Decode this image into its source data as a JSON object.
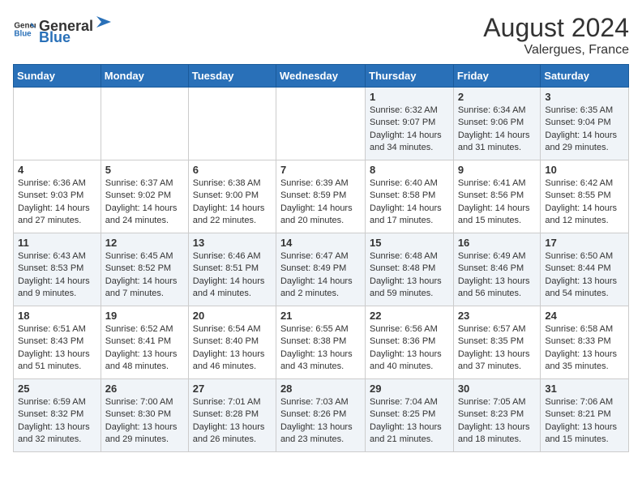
{
  "logo": {
    "text_general": "General",
    "text_blue": "Blue"
  },
  "title": {
    "month_year": "August 2024",
    "location": "Valergues, France"
  },
  "days_of_week": [
    "Sunday",
    "Monday",
    "Tuesday",
    "Wednesday",
    "Thursday",
    "Friday",
    "Saturday"
  ],
  "weeks": [
    [
      {
        "day": "",
        "content": ""
      },
      {
        "day": "",
        "content": ""
      },
      {
        "day": "",
        "content": ""
      },
      {
        "day": "",
        "content": ""
      },
      {
        "day": "1",
        "content": "Sunrise: 6:32 AM\nSunset: 9:07 PM\nDaylight: 14 hours and 34 minutes."
      },
      {
        "day": "2",
        "content": "Sunrise: 6:34 AM\nSunset: 9:06 PM\nDaylight: 14 hours and 31 minutes."
      },
      {
        "day": "3",
        "content": "Sunrise: 6:35 AM\nSunset: 9:04 PM\nDaylight: 14 hours and 29 minutes."
      }
    ],
    [
      {
        "day": "4",
        "content": "Sunrise: 6:36 AM\nSunset: 9:03 PM\nDaylight: 14 hours and 27 minutes."
      },
      {
        "day": "5",
        "content": "Sunrise: 6:37 AM\nSunset: 9:02 PM\nDaylight: 14 hours and 24 minutes."
      },
      {
        "day": "6",
        "content": "Sunrise: 6:38 AM\nSunset: 9:00 PM\nDaylight: 14 hours and 22 minutes."
      },
      {
        "day": "7",
        "content": "Sunrise: 6:39 AM\nSunset: 8:59 PM\nDaylight: 14 hours and 20 minutes."
      },
      {
        "day": "8",
        "content": "Sunrise: 6:40 AM\nSunset: 8:58 PM\nDaylight: 14 hours and 17 minutes."
      },
      {
        "day": "9",
        "content": "Sunrise: 6:41 AM\nSunset: 8:56 PM\nDaylight: 14 hours and 15 minutes."
      },
      {
        "day": "10",
        "content": "Sunrise: 6:42 AM\nSunset: 8:55 PM\nDaylight: 14 hours and 12 minutes."
      }
    ],
    [
      {
        "day": "11",
        "content": "Sunrise: 6:43 AM\nSunset: 8:53 PM\nDaylight: 14 hours and 9 minutes."
      },
      {
        "day": "12",
        "content": "Sunrise: 6:45 AM\nSunset: 8:52 PM\nDaylight: 14 hours and 7 minutes."
      },
      {
        "day": "13",
        "content": "Sunrise: 6:46 AM\nSunset: 8:51 PM\nDaylight: 14 hours and 4 minutes."
      },
      {
        "day": "14",
        "content": "Sunrise: 6:47 AM\nSunset: 8:49 PM\nDaylight: 14 hours and 2 minutes."
      },
      {
        "day": "15",
        "content": "Sunrise: 6:48 AM\nSunset: 8:48 PM\nDaylight: 13 hours and 59 minutes."
      },
      {
        "day": "16",
        "content": "Sunrise: 6:49 AM\nSunset: 8:46 PM\nDaylight: 13 hours and 56 minutes."
      },
      {
        "day": "17",
        "content": "Sunrise: 6:50 AM\nSunset: 8:44 PM\nDaylight: 13 hours and 54 minutes."
      }
    ],
    [
      {
        "day": "18",
        "content": "Sunrise: 6:51 AM\nSunset: 8:43 PM\nDaylight: 13 hours and 51 minutes."
      },
      {
        "day": "19",
        "content": "Sunrise: 6:52 AM\nSunset: 8:41 PM\nDaylight: 13 hours and 48 minutes."
      },
      {
        "day": "20",
        "content": "Sunrise: 6:54 AM\nSunset: 8:40 PM\nDaylight: 13 hours and 46 minutes."
      },
      {
        "day": "21",
        "content": "Sunrise: 6:55 AM\nSunset: 8:38 PM\nDaylight: 13 hours and 43 minutes."
      },
      {
        "day": "22",
        "content": "Sunrise: 6:56 AM\nSunset: 8:36 PM\nDaylight: 13 hours and 40 minutes."
      },
      {
        "day": "23",
        "content": "Sunrise: 6:57 AM\nSunset: 8:35 PM\nDaylight: 13 hours and 37 minutes."
      },
      {
        "day": "24",
        "content": "Sunrise: 6:58 AM\nSunset: 8:33 PM\nDaylight: 13 hours and 35 minutes."
      }
    ],
    [
      {
        "day": "25",
        "content": "Sunrise: 6:59 AM\nSunset: 8:32 PM\nDaylight: 13 hours and 32 minutes."
      },
      {
        "day": "26",
        "content": "Sunrise: 7:00 AM\nSunset: 8:30 PM\nDaylight: 13 hours and 29 minutes."
      },
      {
        "day": "27",
        "content": "Sunrise: 7:01 AM\nSunset: 8:28 PM\nDaylight: 13 hours and 26 minutes."
      },
      {
        "day": "28",
        "content": "Sunrise: 7:03 AM\nSunset: 8:26 PM\nDaylight: 13 hours and 23 minutes."
      },
      {
        "day": "29",
        "content": "Sunrise: 7:04 AM\nSunset: 8:25 PM\nDaylight: 13 hours and 21 minutes."
      },
      {
        "day": "30",
        "content": "Sunrise: 7:05 AM\nSunset: 8:23 PM\nDaylight: 13 hours and 18 minutes."
      },
      {
        "day": "31",
        "content": "Sunrise: 7:06 AM\nSunset: 8:21 PM\nDaylight: 13 hours and 15 minutes."
      }
    ]
  ]
}
